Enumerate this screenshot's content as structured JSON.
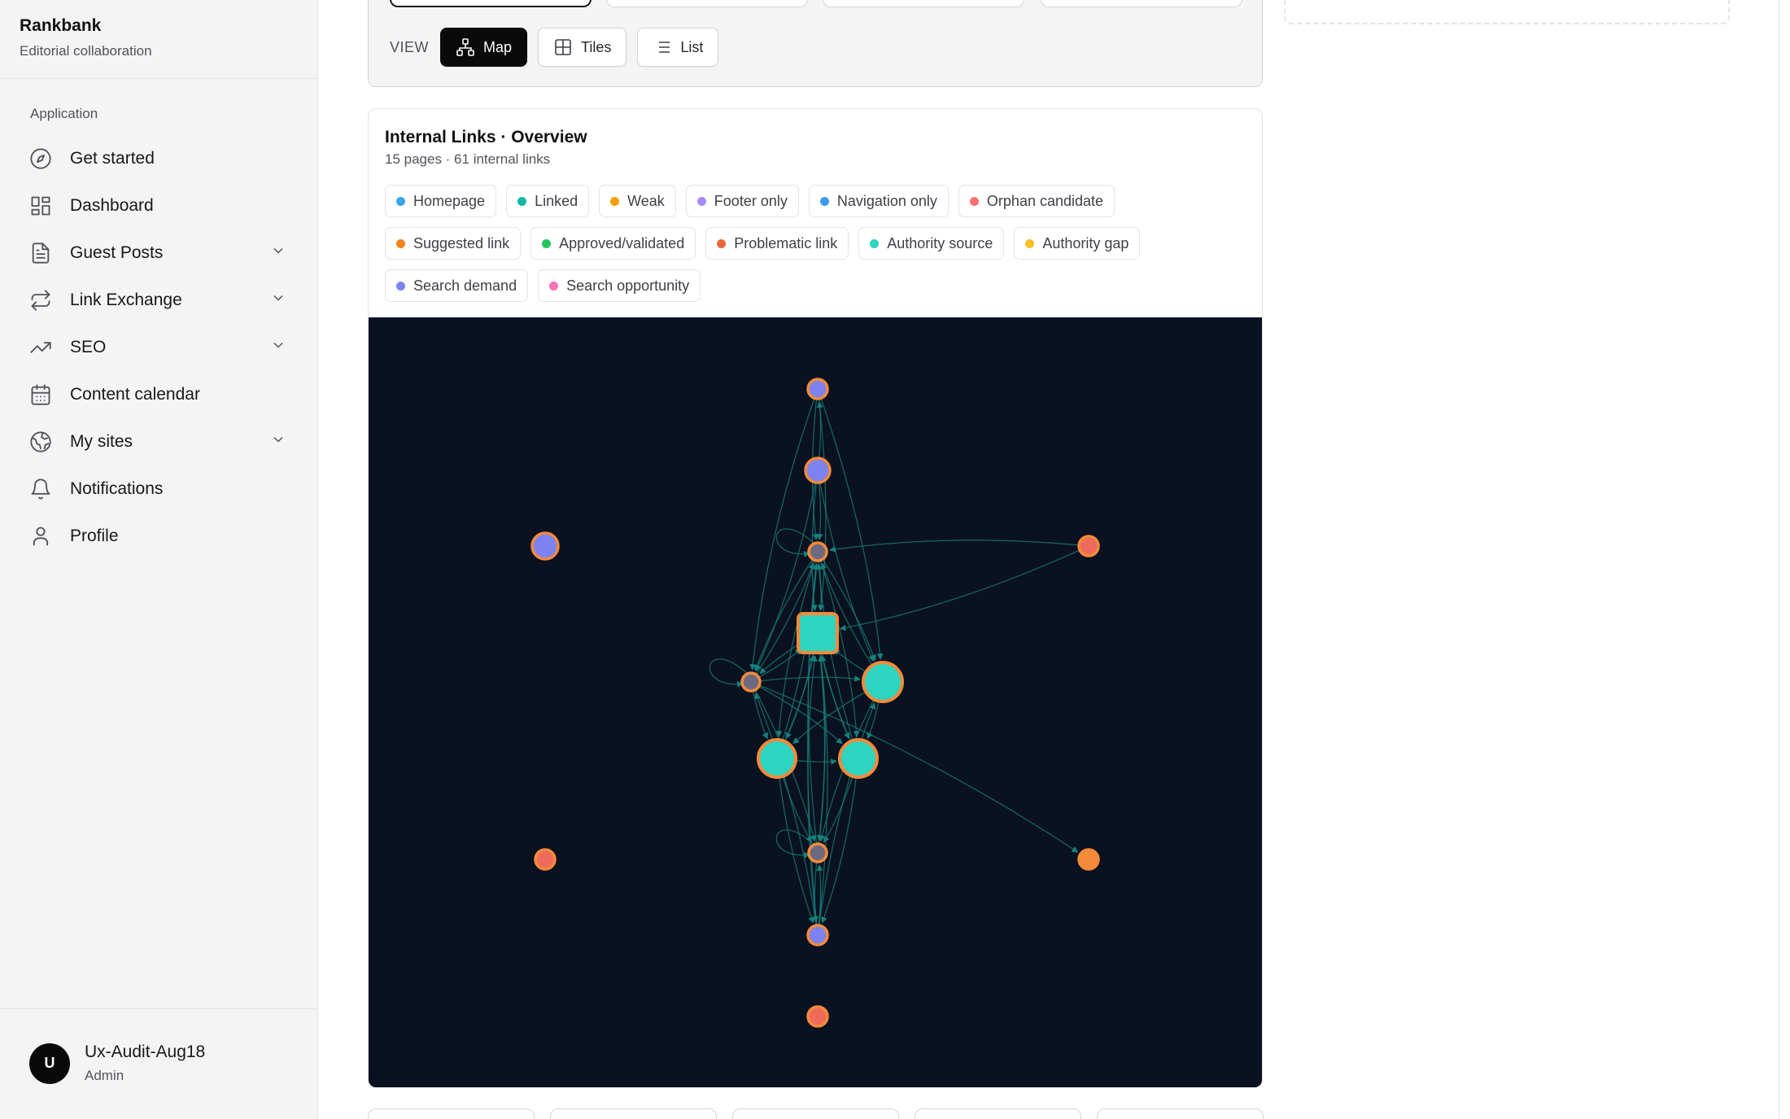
{
  "brand": {
    "name": "Rankbank",
    "subtitle": "Editorial collaboration"
  },
  "sidebar": {
    "section_label": "Application",
    "items": [
      {
        "label": "Get started",
        "icon": "compass-icon",
        "has_chevron": false
      },
      {
        "label": "Dashboard",
        "icon": "dashboard-icon",
        "has_chevron": false
      },
      {
        "label": "Guest Posts",
        "icon": "document-icon",
        "has_chevron": true
      },
      {
        "label": "Link Exchange",
        "icon": "exchange-icon",
        "has_chevron": true
      },
      {
        "label": "SEO",
        "icon": "trending-up-icon",
        "has_chevron": true
      },
      {
        "label": "Content calendar",
        "icon": "calendar-icon",
        "has_chevron": false
      },
      {
        "label": "My sites",
        "icon": "globe-icon",
        "has_chevron": true
      },
      {
        "label": "Notifications",
        "icon": "bell-icon",
        "has_chevron": false
      },
      {
        "label": "Profile",
        "icon": "user-icon",
        "has_chevron": false
      }
    ]
  },
  "user": {
    "initial": "U",
    "name": "Ux-Audit-Aug18",
    "role": "Admin"
  },
  "view": {
    "label": "VIEW",
    "options": [
      {
        "label": "Map",
        "icon": "sitemap-icon",
        "active": true
      },
      {
        "label": "Tiles",
        "icon": "grid-icon",
        "active": false
      },
      {
        "label": "List",
        "icon": "list-icon",
        "active": false
      }
    ]
  },
  "card": {
    "title": "Internal Links · Overview",
    "subtitle": "15 pages · 61 internal links"
  },
  "legend": [
    {
      "label": "Homepage",
      "color": "#3ba4e8"
    },
    {
      "label": "Linked",
      "color": "#14b8a6"
    },
    {
      "label": "Weak",
      "color": "#f59e0b"
    },
    {
      "label": "Footer only",
      "color": "#a78bfa"
    },
    {
      "label": "Navigation only",
      "color": "#3b9be8"
    },
    {
      "label": "Orphan candidate",
      "color": "#f87171"
    },
    {
      "label": "Suggested link",
      "color": "#f5821f"
    },
    {
      "label": "Approved/validated",
      "color": "#22c55e"
    },
    {
      "label": "Problematic link",
      "color": "#e8673c"
    },
    {
      "label": "Authority source",
      "color": "#2dd4bf"
    },
    {
      "label": "Authority gap",
      "color": "#fbbf24"
    },
    {
      "label": "Search demand",
      "color": "#7c83f0"
    },
    {
      "label": "Search opportunity",
      "color": "#f472b6"
    }
  ],
  "graph_colors": {
    "background": "#0a1120",
    "edge": "#17807a",
    "ring": "#f58a3a",
    "authority_fill": "#2dd4bf",
    "demand_fill": "#7c83f0",
    "gap_fill": "#ee6a5a"
  }
}
